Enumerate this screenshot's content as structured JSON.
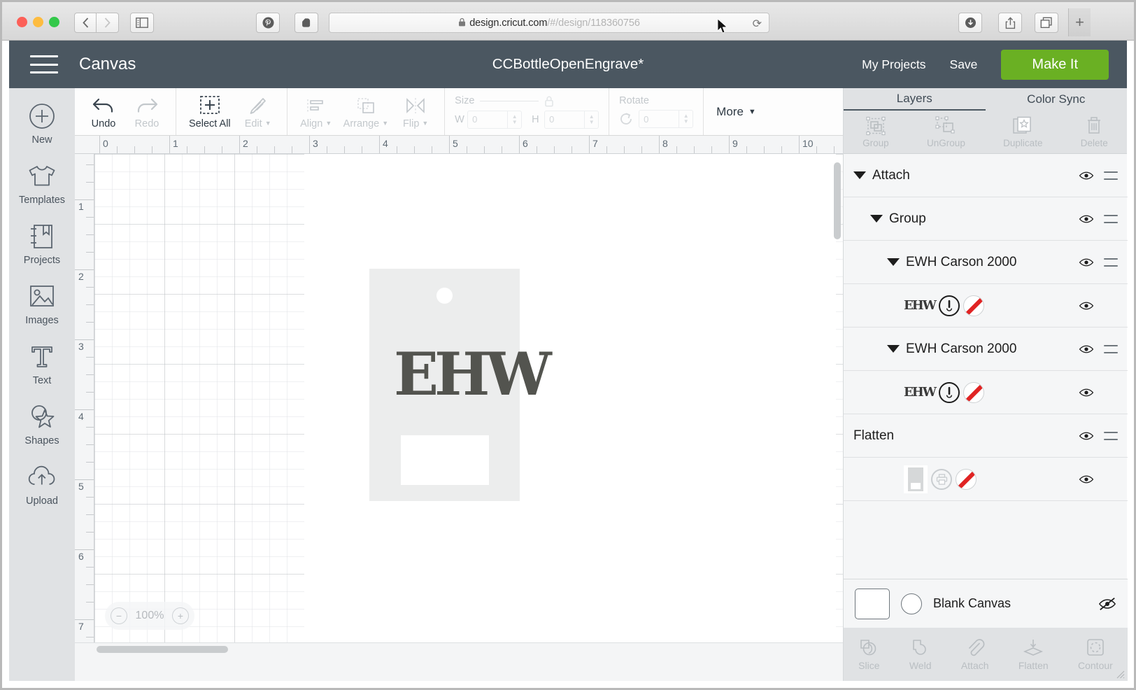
{
  "browser": {
    "url_host": "design.cricut.com",
    "url_path": "/#/design/118360756",
    "lock_icon": "lock-icon",
    "back_icon": "chevron-left-icon",
    "forward_icon": "chevron-right-icon",
    "sidebar_icon": "sidebar-toggle-icon",
    "reload_icon": "reload-icon",
    "pinterest_icon": "pinterest-icon",
    "evernote_icon": "evernote-icon",
    "add_extension_icon": "plus-circle-icon",
    "download_icon": "download-icon",
    "share_icon": "share-icon",
    "tabs_icon": "show-tabs-icon",
    "new_tab_label": "+"
  },
  "header": {
    "menu_icon": "hamburger-menu-icon",
    "canvas_label": "Canvas",
    "document_title": "CCBottleOpenEngrave*",
    "my_projects_label": "My Projects",
    "save_label": "Save",
    "make_it_label": "Make It",
    "bg_color": "#4b5761",
    "make_it_color": "#6ab023"
  },
  "left_rail": {
    "items": [
      {
        "label": "New",
        "icon": "plus-circle-icon"
      },
      {
        "label": "Templates",
        "icon": "tshirt-icon"
      },
      {
        "label": "Projects",
        "icon": "bookmark-book-icon"
      },
      {
        "label": "Images",
        "icon": "photo-icon"
      },
      {
        "label": "Text",
        "icon": "text-t-icon"
      },
      {
        "label": "Shapes",
        "icon": "star-shapes-icon"
      },
      {
        "label": "Upload",
        "icon": "cloud-upload-icon"
      }
    ]
  },
  "toolbar": {
    "undo_label": "Undo",
    "redo_label": "Redo",
    "select_all_label": "Select All",
    "edit_label": "Edit",
    "align_label": "Align",
    "arrange_label": "Arrange",
    "flip_label": "Flip",
    "size_label": "Size",
    "width_label": "W",
    "height_label": "H",
    "width_value": "0",
    "height_value": "0",
    "lock_icon": "lock-closed-icon",
    "rotate_label": "Rotate",
    "rotate_value": "0",
    "more_label": "More"
  },
  "rulers": {
    "horizontal": [
      "0",
      "1",
      "2",
      "3",
      "4",
      "5",
      "6",
      "7",
      "8",
      "9",
      "10"
    ],
    "vertical": [
      "1",
      "2",
      "3",
      "4",
      "5",
      "6",
      "7"
    ]
  },
  "canvas": {
    "zoom_value": "100%",
    "zoom_out_label": "−",
    "zoom_in_label": "+",
    "monogram_text": "EHW",
    "tag_color": "#eceded",
    "monogram_color": "#53544f"
  },
  "right_panel": {
    "tabs": [
      {
        "label": "Layers",
        "active": true
      },
      {
        "label": "Color Sync",
        "active": false
      }
    ],
    "actions": [
      {
        "label": "Group",
        "icon": "group-icon"
      },
      {
        "label": "UnGroup",
        "icon": "ungroup-icon"
      },
      {
        "label": "Duplicate",
        "icon": "duplicate-icon"
      },
      {
        "label": "Delete",
        "icon": "trash-icon"
      }
    ],
    "layers": [
      {
        "name": "Attach",
        "indent": 0,
        "type": "group",
        "has_caret": true,
        "has_drag": true
      },
      {
        "name": "Group",
        "indent": 1,
        "type": "group",
        "has_caret": true,
        "has_drag": true
      },
      {
        "name": "EWH Carson 2000",
        "indent": 2,
        "type": "group",
        "has_caret": true,
        "has_drag": true
      },
      {
        "name": "",
        "indent": 3,
        "type": "engrave",
        "thumb_text": "EHW",
        "has_caret": false,
        "has_drag": false
      },
      {
        "name": "EWH Carson 2000",
        "indent": 2,
        "type": "group",
        "has_caret": true,
        "has_drag": true
      },
      {
        "name": "",
        "indent": 3,
        "type": "engrave",
        "thumb_text": "EHW",
        "has_caret": false,
        "has_drag": false
      },
      {
        "name": "Flatten",
        "indent": 0,
        "type": "flatten",
        "has_caret": false,
        "has_drag": true
      },
      {
        "name": "",
        "indent": 3,
        "type": "print",
        "has_caret": false,
        "has_drag": false
      }
    ],
    "canvas_strip": {
      "label": "Blank Canvas",
      "hidden_icon": "eye-slash-icon",
      "swatch_color": "#ffffff"
    },
    "bottom_tools": [
      {
        "label": "Slice",
        "icon": "slice-icon"
      },
      {
        "label": "Weld",
        "icon": "weld-icon"
      },
      {
        "label": "Attach",
        "icon": "paperclip-icon"
      },
      {
        "label": "Flatten",
        "icon": "flatten-layers-icon"
      },
      {
        "label": "Contour",
        "icon": "contour-icon"
      }
    ]
  }
}
